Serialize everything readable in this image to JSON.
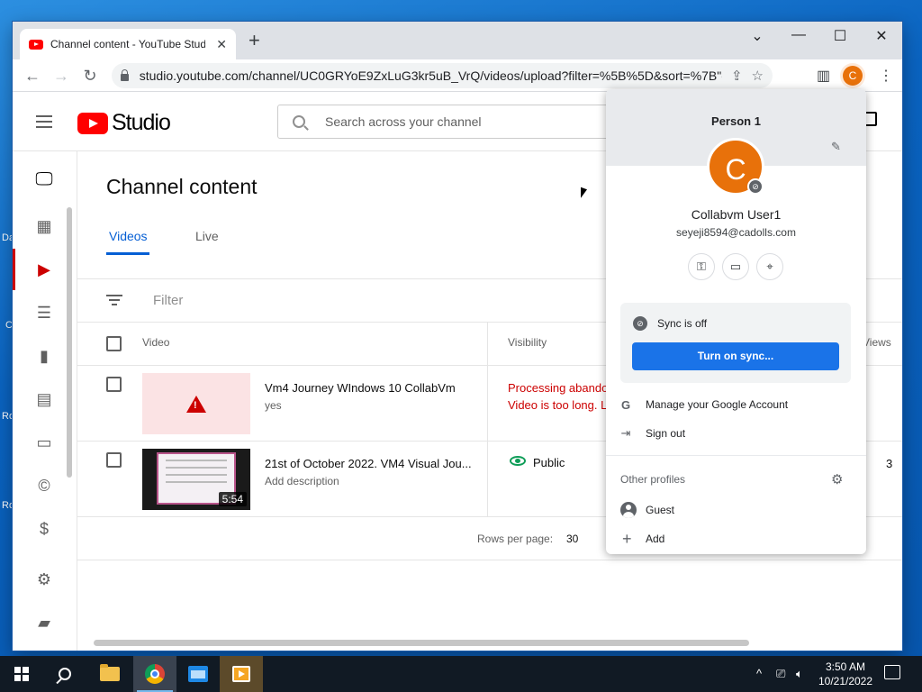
{
  "desktop": {
    "icon_fragments": [
      "Da",
      "C",
      "Ro",
      "Ro"
    ]
  },
  "browser": {
    "tab_title": "Channel content - YouTube Studio",
    "tab_close": "✕",
    "new_tab": "+",
    "window_controls": {
      "minimize": "—",
      "maximize": "☐",
      "close": "✕",
      "tab_search": "⌄"
    },
    "url": "studio.youtube.com/channel/UC0GRYoE9ZxLuG3kr5uB_VrQ/videos/upload?filter=%5B%5D&sort=%7B\"col...",
    "nav": {
      "back": "←",
      "forward": "→",
      "reload": "↻"
    },
    "profile_initial": "C",
    "menu": "⋮"
  },
  "studio": {
    "logo_text": "Studio",
    "search_placeholder": "Search across your channel",
    "page_title": "Channel content",
    "tabs": [
      {
        "label": "Videos",
        "active": true
      },
      {
        "label": "Live",
        "active": false
      }
    ],
    "filter_label": "Filter",
    "columns": {
      "video": "Video",
      "visibility": "Visibility",
      "views": "Views"
    },
    "rows": [
      {
        "title": "Vm4 Journey WIndows 10 CollabVm",
        "description": "yes",
        "status_line1": "Processing abando",
        "status_line2": "Video is too long. Le"
      },
      {
        "title": "21st of October 2022. VM4 Visual Jou...",
        "description": "Add description",
        "duration": "5:54",
        "visibility": "Public",
        "views": "3"
      }
    ],
    "rows_per_page_label": "Rows per page:",
    "rows_per_page_value": "30",
    "nav_icons": [
      "dashboard-icon",
      "content-icon",
      "playlists-icon",
      "analytics-icon",
      "comments-icon",
      "subtitles-icon",
      "copyright-icon",
      "earn-icon",
      "settings-icon",
      "feedback-icon"
    ],
    "accent": "#065fd4",
    "brand_red": "#ff0000"
  },
  "profile_popup": {
    "header_name": "Person 1",
    "avatar_initial": "C",
    "user_name": "Collabvm User1",
    "email": "seyeji8594@cadolls.com",
    "sync_status": "Sync is off",
    "sync_button": "Turn on sync...",
    "manage_account": "Manage your Google Account",
    "sign_out": "Sign out",
    "other_profiles": "Other profiles",
    "guest": "Guest",
    "add": "Add",
    "avatar_color": "#e8710a",
    "button_color": "#1a73e8"
  },
  "taskbar": {
    "time": "3:50 AM",
    "date": "10/21/2022",
    "tray_chevron": "^"
  }
}
